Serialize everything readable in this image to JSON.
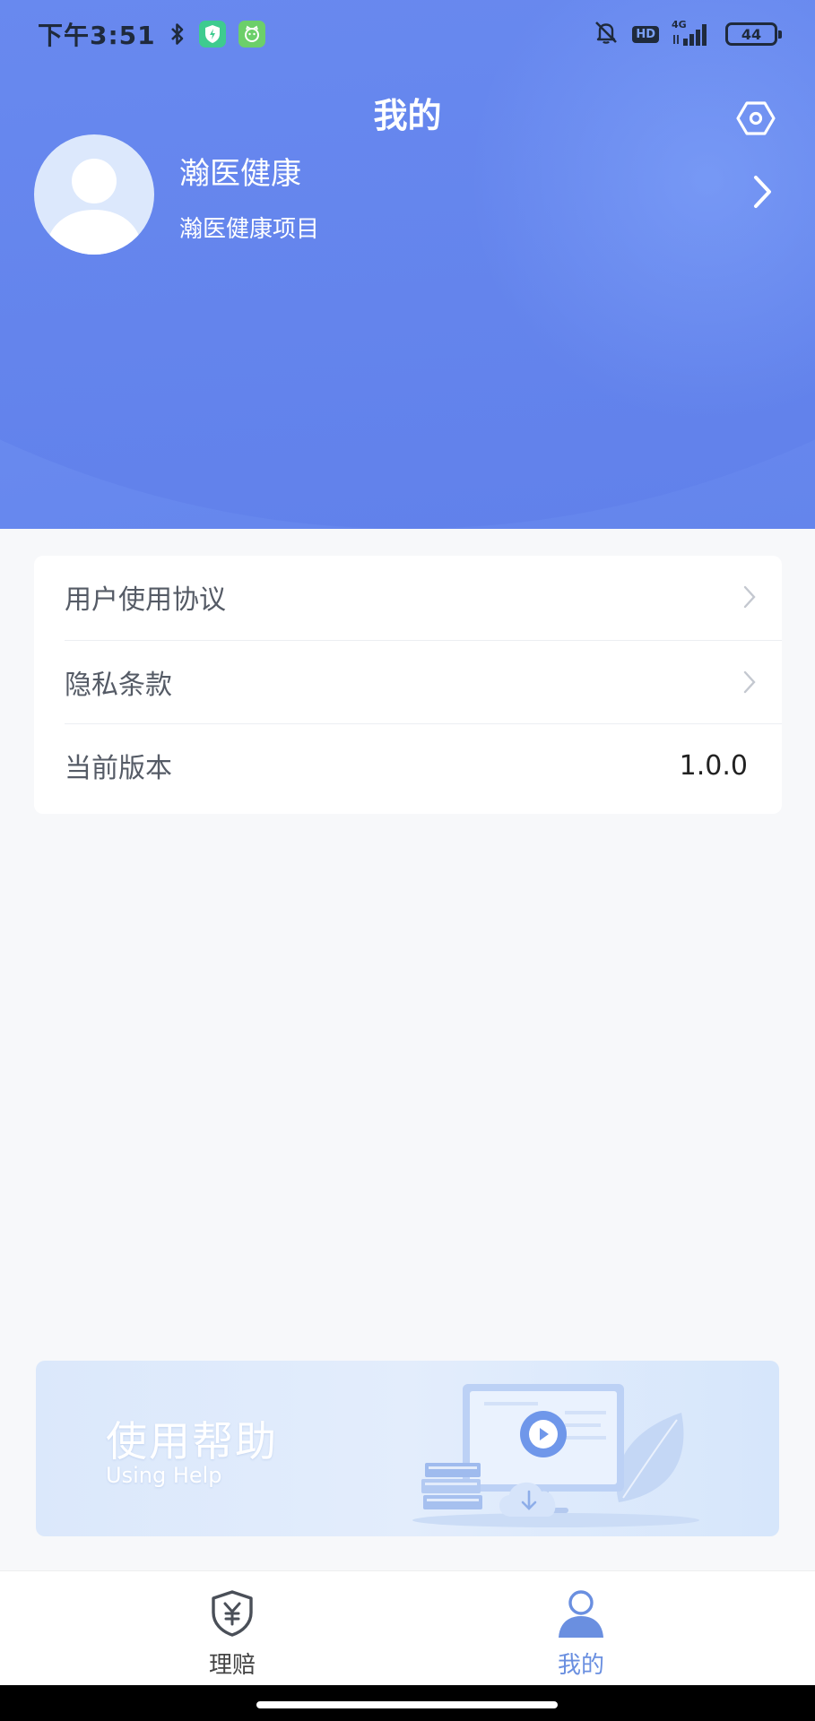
{
  "status_bar": {
    "time": "下午3:51",
    "hd_label": "HD",
    "network_label": "4G",
    "battery": "44"
  },
  "header": {
    "title": "我的"
  },
  "profile": {
    "name": "瀚医健康",
    "subtitle": "瀚医健康项目"
  },
  "menu": {
    "items": [
      {
        "label": "用户使用协议"
      },
      {
        "label": "隐私条款"
      },
      {
        "label": "当前版本",
        "value": "1.0.0"
      }
    ]
  },
  "help_banner": {
    "title": "使用帮助",
    "subtitle": "Using Help"
  },
  "tab_bar": {
    "tabs": [
      {
        "label": "理赔",
        "icon": "shield-yen-icon",
        "active": false
      },
      {
        "label": "我的",
        "icon": "user-icon",
        "active": true
      }
    ]
  },
  "colors": {
    "header_blue": "#6b8cf0",
    "active_tab": "#6a8fe0",
    "inactive_tab": "#444444"
  }
}
